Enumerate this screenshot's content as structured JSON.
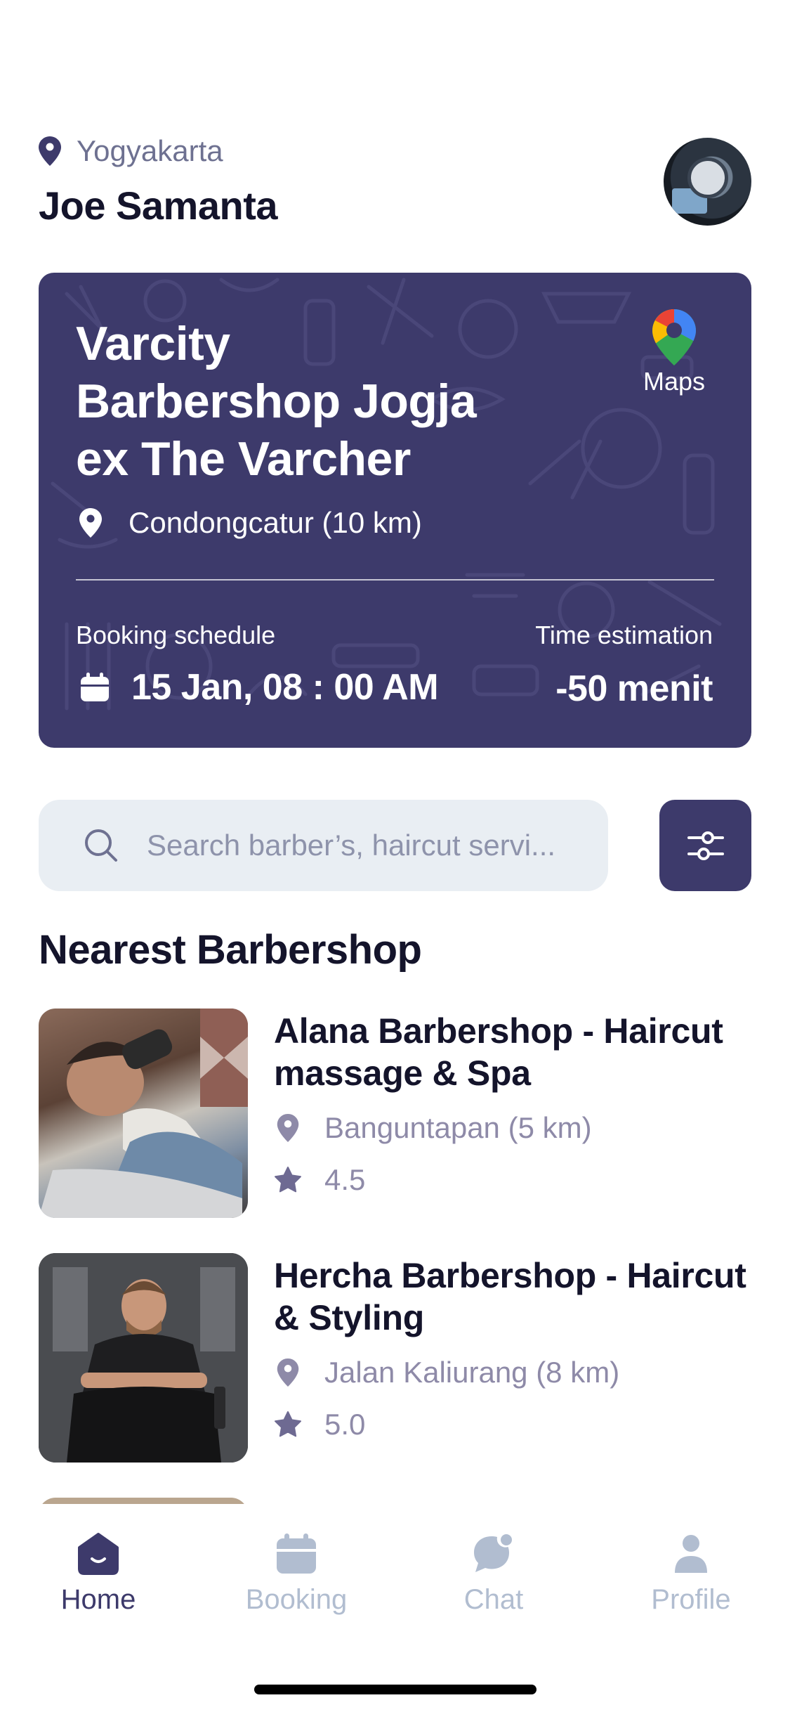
{
  "header": {
    "location": "Yogyakarta",
    "user_name": "Joe Samanta"
  },
  "featured": {
    "title": "Varcity Barbershop Jogja ex The Varcher",
    "maps_label": "Maps",
    "location": "Condongcatur (10 km)",
    "schedule_label": "Booking schedule",
    "schedule_value": "15 Jan, 08 : 00 AM",
    "time_label": "Time estimation",
    "time_value": "-50 menit"
  },
  "search": {
    "placeholder": "Search barber’s, haircut servi..."
  },
  "nearest": {
    "title": "Nearest Barbershop",
    "items": [
      {
        "name": "Alana Barbershop - Haircut massage & Spa",
        "location": "Banguntapan (5 km)",
        "rating": "4.5"
      },
      {
        "name": "Hercha Barbershop - Haircut & Styling",
        "location": "Jalan Kaliurang (8 km)",
        "rating": "5.0"
      }
    ]
  },
  "tabs": [
    {
      "label": "Home",
      "icon": "home-icon",
      "active": true
    },
    {
      "label": "Booking",
      "icon": "calendar-icon",
      "active": false
    },
    {
      "label": "Chat",
      "icon": "chat-icon",
      "active": false
    },
    {
      "label": "Profile",
      "icon": "profile-icon",
      "active": false
    }
  ],
  "colors": {
    "primary": "#3d3a6b",
    "text_dark": "#14142b",
    "text_muted": "#8e8aa8",
    "tab_inactive": "#b1bdd0",
    "search_bg": "#e9eef3"
  }
}
